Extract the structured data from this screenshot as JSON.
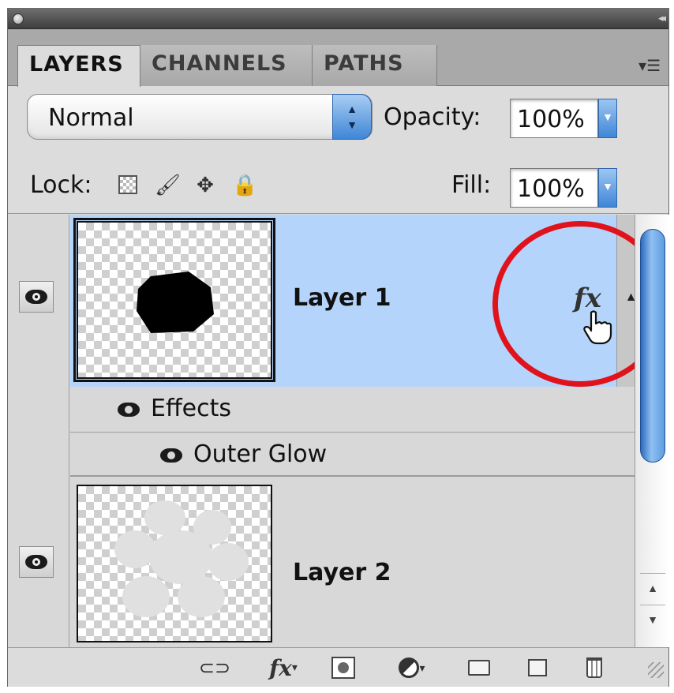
{
  "tabs": [
    {
      "label": "LAYERS",
      "active": true
    },
    {
      "label": "CHANNELS",
      "active": false
    },
    {
      "label": "PATHS",
      "active": false
    }
  ],
  "blend_mode": {
    "value": "Normal"
  },
  "opacity": {
    "label": "Opacity:",
    "value": "100%"
  },
  "lock": {
    "label": "Lock:"
  },
  "fill": {
    "label": "Fill:",
    "value": "100%"
  },
  "layers": [
    {
      "name": "Layer 1",
      "selected": true,
      "visible": true,
      "fx_badge": "fx",
      "effects_label": "Effects",
      "effects": [
        {
          "name": "Outer Glow",
          "visible": true
        }
      ]
    },
    {
      "name": "Layer 2",
      "selected": false,
      "visible": true
    }
  ],
  "toolbar": {
    "fx_label": "fx"
  },
  "colors": {
    "selection": "#b4d4fb",
    "highlight_circle": "#e0121b",
    "scroll_thumb": "#5d9ce0"
  },
  "icons": [
    "eye-icon",
    "link-layers-icon",
    "fx-icon",
    "layer-mask-icon",
    "adjustment-layer-icon",
    "new-group-icon",
    "new-layer-icon",
    "trash-icon",
    "hand-cursor-icon"
  ]
}
